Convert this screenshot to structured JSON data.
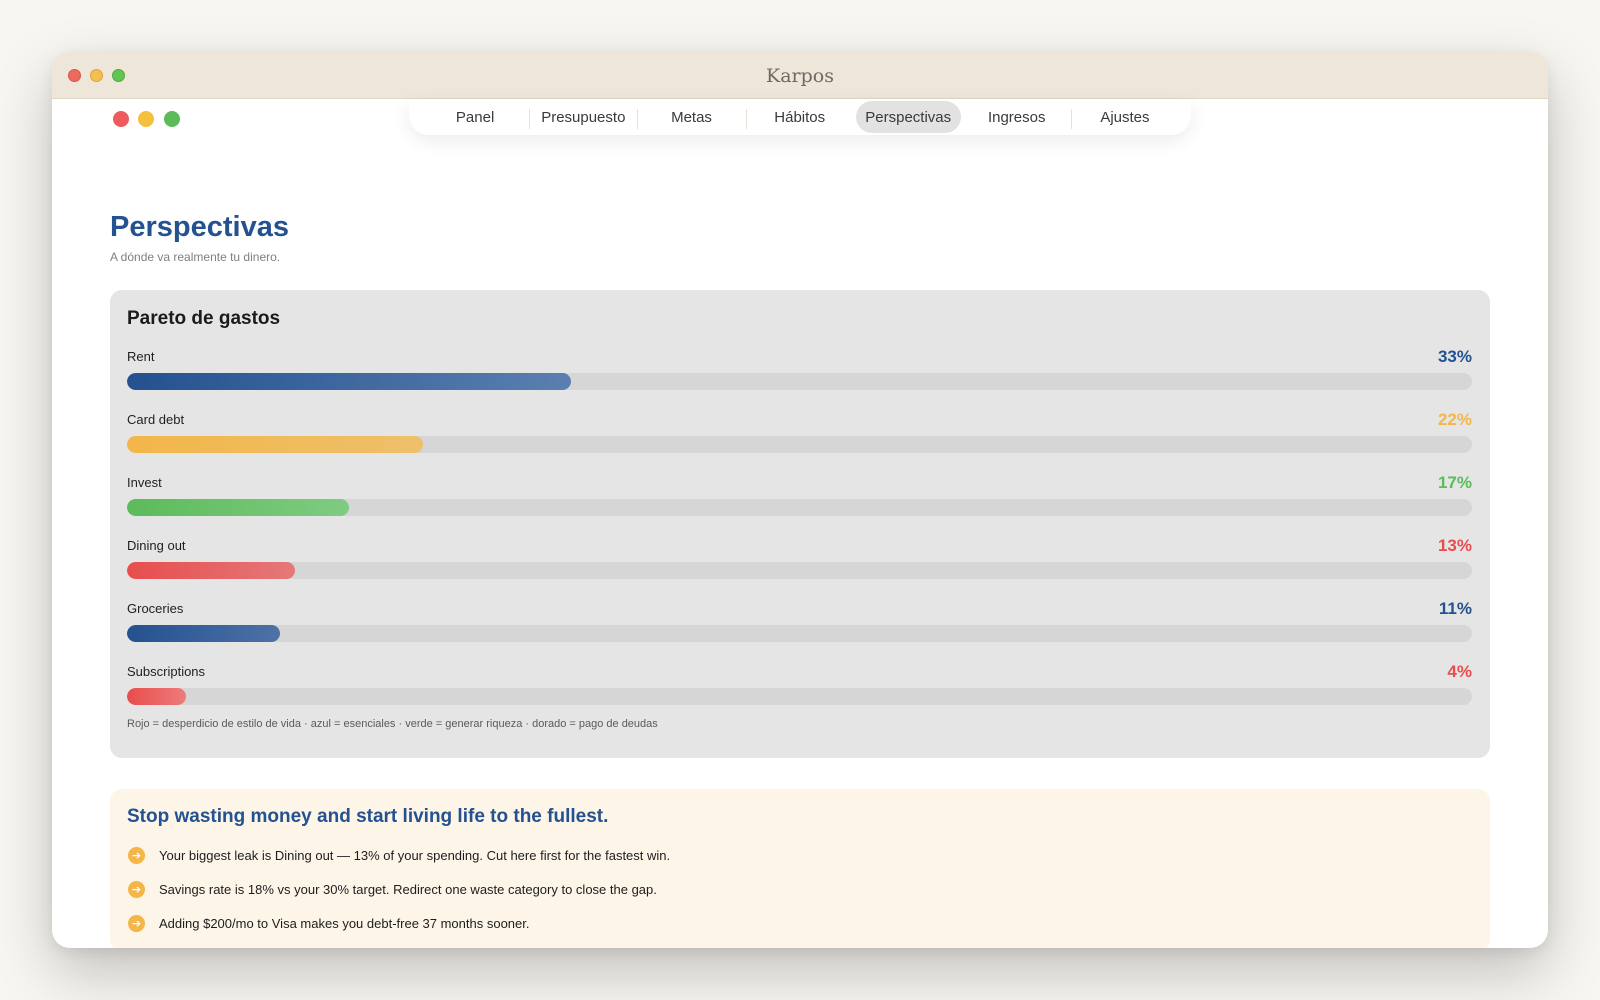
{
  "window": {
    "title": "Karpos"
  },
  "nav": {
    "tabs": [
      {
        "label": "Panel",
        "name": "panel"
      },
      {
        "label": "Presupuesto",
        "name": "presupuesto"
      },
      {
        "label": "Metas",
        "name": "metas"
      },
      {
        "label": "Hábitos",
        "name": "habitos"
      },
      {
        "label": "Perspectivas",
        "name": "perspectivas",
        "active": true
      },
      {
        "label": "Ingresos",
        "name": "ingresos"
      },
      {
        "label": "Ajustes",
        "name": "ajustes"
      }
    ]
  },
  "page": {
    "title": "Perspectivas",
    "subtitle": "A dónde va realmente tu dinero."
  },
  "pareto": {
    "title": "Pareto de gastos",
    "items": [
      {
        "label": "Rent",
        "pct_label": "33%",
        "fill": 0.33,
        "color": "#24518f",
        "color_end": "#5b7fb0"
      },
      {
        "label": "Card debt",
        "pct_label": "22%",
        "fill": 0.22,
        "color": "#f2b64a",
        "color_end": "#eec06a"
      },
      {
        "label": "Invest",
        "pct_label": "17%",
        "fill": 0.165,
        "color": "#5cbb5a",
        "color_end": "#7fcb82"
      },
      {
        "label": "Dining out",
        "pct_label": "13%",
        "fill": 0.125,
        "color": "#e84d4d",
        "color_end": "#e4797a"
      },
      {
        "label": "Groceries",
        "pct_label": "11%",
        "fill": 0.114,
        "color": "#24518f",
        "color_end": "#4d72a7"
      },
      {
        "label": "Subscriptions",
        "pct_label": "4%",
        "fill": 0.044,
        "color": "#e84d4d",
        "color_end": "#ef7b7b"
      }
    ],
    "legend": "Rojo = desperdicio de estilo de vida · azul = esenciales · verde = generar riqueza · dorado = pago de deudas"
  },
  "tips": {
    "title": "Stop wasting money and start living life to the fullest.",
    "icon": "arrow-right-icon",
    "accent": "#f2b64a",
    "items": [
      "Your biggest leak is Dining out — 13% of your spending. Cut here first for the fastest win.",
      "Savings rate is 18% vs your 30% target. Redirect one waste category to close the gap.",
      "Adding $200/mo to Visa makes you debt-free 37 months sooner."
    ]
  }
}
